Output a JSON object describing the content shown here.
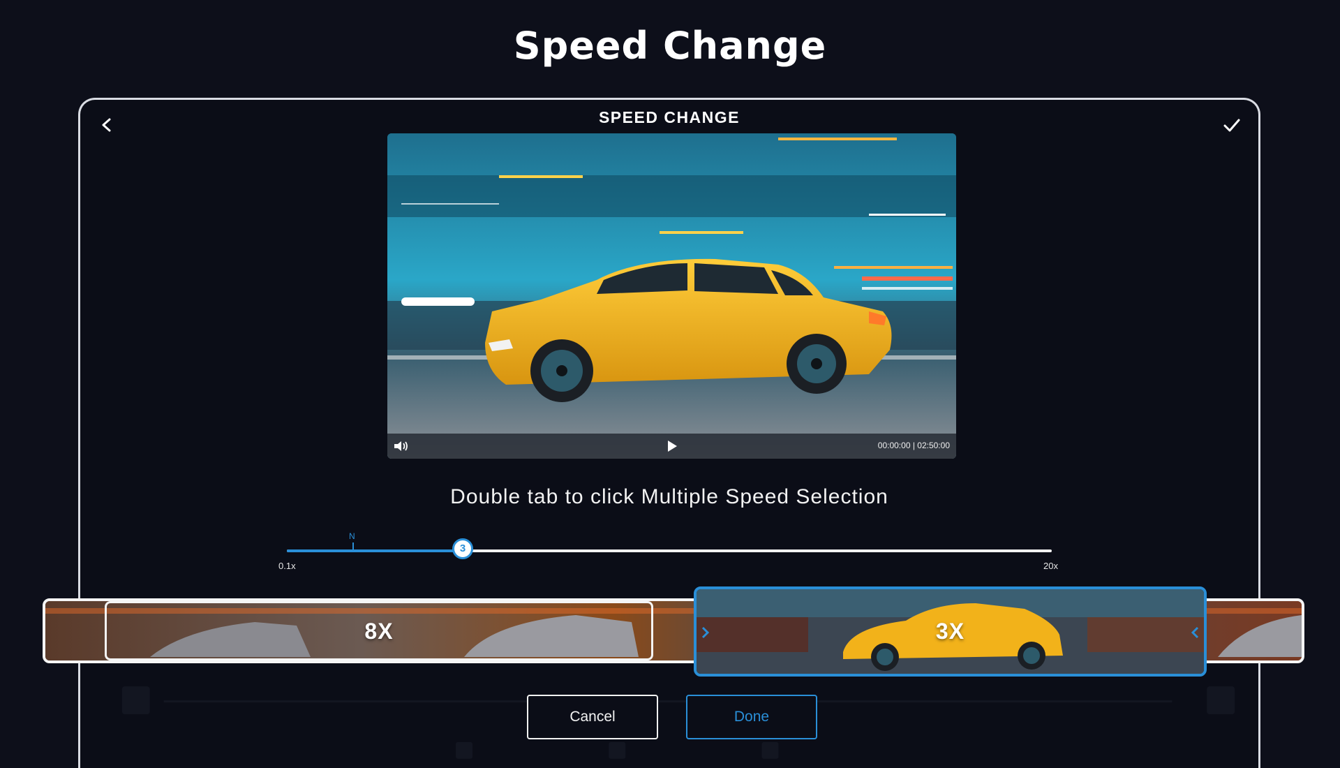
{
  "page": {
    "heading": "Speed Change"
  },
  "screen": {
    "title": "SPEED CHANGE",
    "back_icon": "chevron-left-icon",
    "confirm_icon": "checkmark-icon"
  },
  "player": {
    "time": "00:00:00 | 02:50:00",
    "volume_icon": "volume-icon",
    "play_icon": "play-icon"
  },
  "hint": "Double tab to click Multiple Speed Selection",
  "slider": {
    "min_label": "0.1x",
    "max_label": "20x",
    "normal_label": "N",
    "value": "3"
  },
  "timeline": {
    "segments": [
      {
        "label": "8X"
      },
      {
        "label": "3X"
      }
    ]
  },
  "buttons": {
    "cancel": "Cancel",
    "done": "Done"
  },
  "colors": {
    "accent": "#2a8fd8",
    "background": "#0d0f1a",
    "car": "#f2b21a"
  }
}
